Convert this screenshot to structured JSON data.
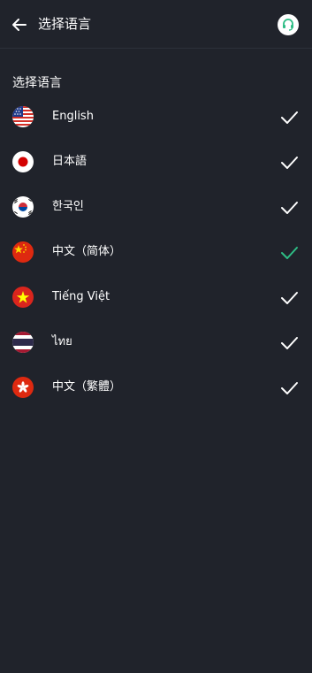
{
  "header": {
    "title": "选择语言",
    "back_icon": "arrow-left-icon",
    "support_icon": "headset-support-icon"
  },
  "section": {
    "title": "选择语言"
  },
  "languages": [
    {
      "label": "English",
      "flag": "us-flag-icon",
      "selected": false
    },
    {
      "label": "日本語",
      "flag": "jp-flag-icon",
      "selected": false
    },
    {
      "label": "한국인",
      "flag": "kr-flag-icon",
      "selected": false
    },
    {
      "label": "中文（简体）",
      "flag": "cn-flag-icon",
      "selected": true
    },
    {
      "label": "Tiếng Việt",
      "flag": "vn-flag-icon",
      "selected": false
    },
    {
      "label": "ไทย",
      "flag": "th-flag-icon",
      "selected": false
    },
    {
      "label": "中文（繁體）",
      "flag": "hk-flag-icon",
      "selected": false
    }
  ],
  "colors": {
    "background": "#20232b",
    "check_default": "#ffffff",
    "check_selected": "#2ebd85",
    "support_accent": "#2ebd85"
  }
}
